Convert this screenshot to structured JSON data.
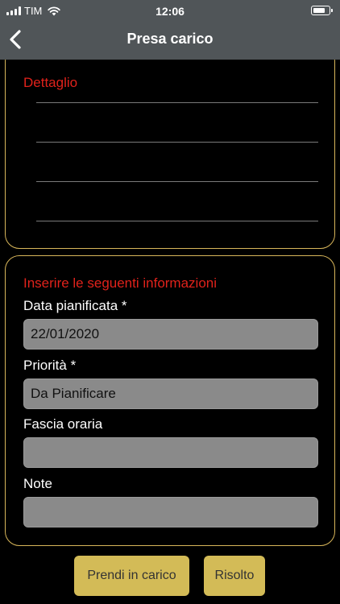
{
  "status_bar": {
    "carrier": "TIM",
    "time": "12:06"
  },
  "nav": {
    "title": "Presa carico",
    "back_icon": "chevron-left-icon"
  },
  "detail_card": {
    "title": "Dettaglio"
  },
  "form_card": {
    "title": "Inserire le seguenti informazioni",
    "fields": [
      {
        "label": "Data pianificata *",
        "value": "22/01/2020"
      },
      {
        "label": "Priorità *",
        "value": "Da Pianificare"
      },
      {
        "label": "Fascia oraria",
        "value": ""
      },
      {
        "label": "Note",
        "value": ""
      }
    ]
  },
  "actions": {
    "take_label": "Prendi in carico",
    "solved_label": "Risolto"
  },
  "colors": {
    "accent": "#d3bb57",
    "title_red": "#e0221b",
    "nav_bg": "#505558",
    "background": "#000000"
  }
}
